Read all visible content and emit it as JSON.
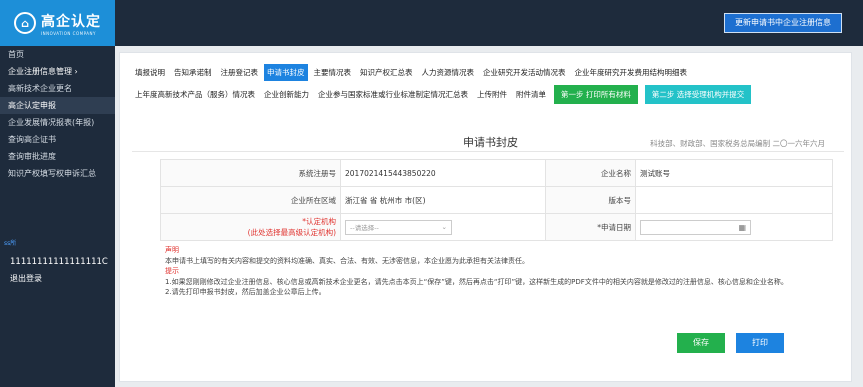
{
  "brand": {
    "title": "高企认定",
    "subtitle": "INNOVATION COMPANY"
  },
  "header": {
    "update_button": "更新申请书中企业注册信息"
  },
  "sidebar": {
    "items": [
      {
        "label": "首页"
      },
      {
        "label": "企业注册信息管理  ›"
      },
      {
        "label": "高新技术企业更名"
      },
      {
        "label": "高企认定申报"
      },
      {
        "label": "企业发展情况报表(年报)"
      },
      {
        "label": "查询高企证书"
      },
      {
        "label": "查询审批进度"
      },
      {
        "label": "知识产权填写权申诉汇总"
      }
    ],
    "user_label": "ss所",
    "user_id": "11111111111111111C",
    "logout": "退出登录"
  },
  "tabs": {
    "row1": [
      "填报说明",
      "告知承诺制",
      "注册登记表",
      "申请书封皮",
      "主要情况表",
      "知识产权汇总表",
      "人力资源情况表",
      "企业研究开发活动情况表",
      "企业年度研究开发费用结构明细表"
    ],
    "row2": [
      "上年度高新技术产品（服务）情况表",
      "企业创新能力",
      "企业参与国家标准或行业标准制定情况汇总表",
      "上传附件",
      "附件清单"
    ],
    "step1": "第一步 打印所有材料",
    "step2": "第二步 选择受理机构并提交"
  },
  "form": {
    "title": "申请书封皮",
    "meta": "科技部、财政部、国家税务总局编制 二〇一六年六月",
    "reg_no_label": "系统注册号",
    "reg_no": "2017021415443850220",
    "company_label": "企业名称",
    "company": "测试账号",
    "region_label": "企业所在区域",
    "region": "浙江省 省 杭州市 市(区)",
    "version_label": "版本号",
    "version": "",
    "agency_label": "*认定机构",
    "agency_hint": "(此处选择最高级认定机构)",
    "agency_select": "--请选择--",
    "date_label": "*申请日期",
    "date_value": ""
  },
  "notes": {
    "declare_title": "声明",
    "declare_text": "本申请书上填写的有关内容和提交的资料均准确、真实、合法、有效、无涉密信息，本企业愿为此承担有关法律责任。",
    "tips_title": "提示",
    "tip1": "1.如果您刚刚修改过企业注册信息、核心信息或高新技术企业更名，请先点击本页上“保存”键，然后再点击“打印”键，这样新生成的PDF文件中的相关内容就是修改过的注册信息、核心信息和企业名称。",
    "tip2": "2.请先打印申报书封皮，然后加盖企业公章后上传。"
  },
  "actions": {
    "save": "保存",
    "print": "打印"
  },
  "colors": {
    "sidebar": "#1e2b3c",
    "accent_blue": "#1d83e0",
    "green": "#23b04d",
    "cyan": "#23c2c8",
    "required": "#e0322e"
  }
}
